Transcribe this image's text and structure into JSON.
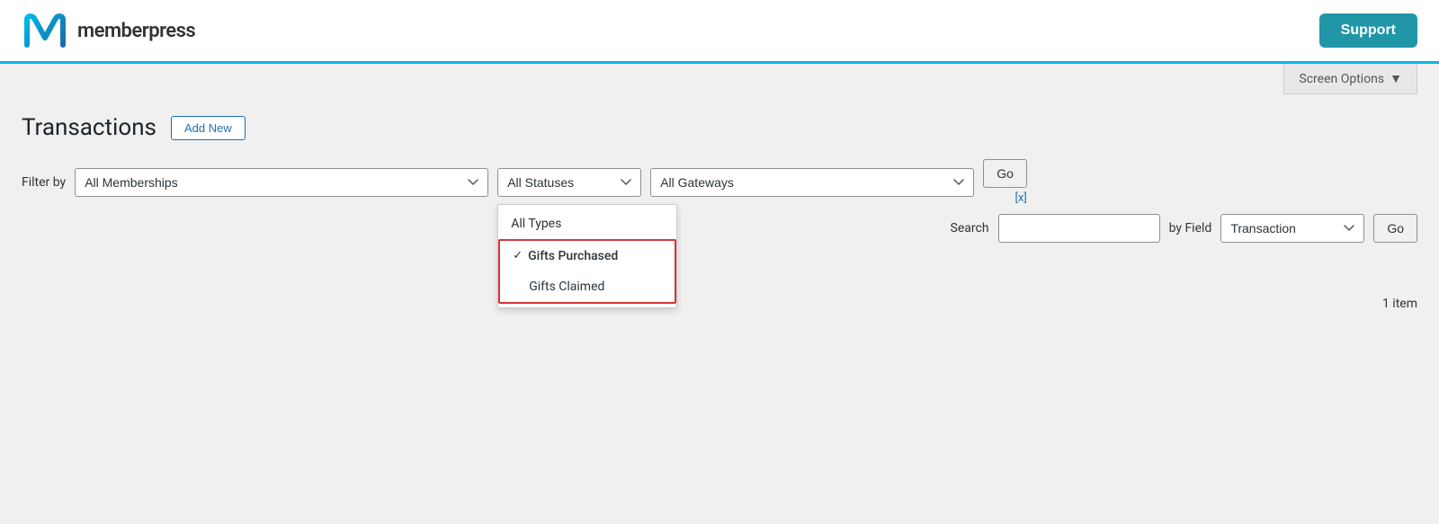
{
  "header": {
    "logo_text": "memberpress",
    "support_label": "Support"
  },
  "screen_options": {
    "label": "Screen Options",
    "arrow": "▼"
  },
  "page": {
    "title": "Transactions",
    "add_new_label": "Add New"
  },
  "filter": {
    "filter_by_label": "Filter by",
    "membership_placeholder": "All Memberships",
    "statuses_placeholder": "All Statuses",
    "gateway_placeholder": "All Gateways",
    "go_label": "Go",
    "x_label": "[x]"
  },
  "types_dropdown": {
    "all_types_label": "All Types",
    "gifts_purchased_label": "Gifts Purchased",
    "gifts_claimed_label": "Gifts Claimed"
  },
  "search": {
    "label": "Search",
    "by_field_label": "by Field",
    "placeholder": "",
    "field_value": "Transaction",
    "go_label": "Go"
  },
  "footer": {
    "items_count": "1 item"
  }
}
